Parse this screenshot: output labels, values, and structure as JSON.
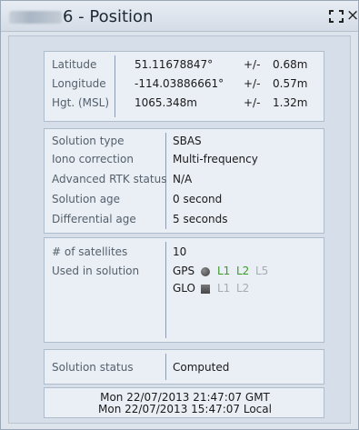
{
  "window": {
    "title": "6 - Position",
    "expand_icon": "expand-corners-icon",
    "close_glyph": "×"
  },
  "position": {
    "latitude": {
      "label": "Latitude",
      "value": "51.11678847°",
      "pm": "+/-",
      "err": "0.68m"
    },
    "longitude": {
      "label": "Longitude",
      "value": "-114.03886661°",
      "pm": "+/-",
      "err": "0.57m"
    },
    "height": {
      "label": "Hgt. (MSL)",
      "value": "1065.348m",
      "pm": "+/-",
      "err": "1.32m"
    }
  },
  "solution": {
    "type": {
      "label": "Solution type",
      "value": "SBAS"
    },
    "iono": {
      "label": "Iono correction",
      "value": "Multi-frequency"
    },
    "rtk": {
      "label": "Advanced RTK status",
      "value": "N/A"
    },
    "age": {
      "label": "Solution age",
      "value": "0 second"
    },
    "diff_age": {
      "label": "Differential age",
      "value": "5 seconds"
    }
  },
  "satellites": {
    "count_label": "# of satellites",
    "count_value": "10",
    "used_label": "Used in solution",
    "gps": {
      "name": "GPS",
      "icon": "gps-circle-icon",
      "l1": "L1",
      "l2": "L2",
      "l5": "L5"
    },
    "glo": {
      "name": "GLO",
      "icon": "glonass-square-icon",
      "l1": "L1",
      "l2": "L2"
    }
  },
  "status": {
    "label": "Solution status",
    "value": "Computed"
  },
  "time": {
    "gmt": "Mon 22/07/2013 21:47:07 GMT",
    "local": "Mon 22/07/2013 15:47:07 Local"
  },
  "colors": {
    "active_signal": "#3c9a2c",
    "inactive_signal": "#a6acb3",
    "panel": "#d6dfe9",
    "group": "#eaeff5"
  }
}
